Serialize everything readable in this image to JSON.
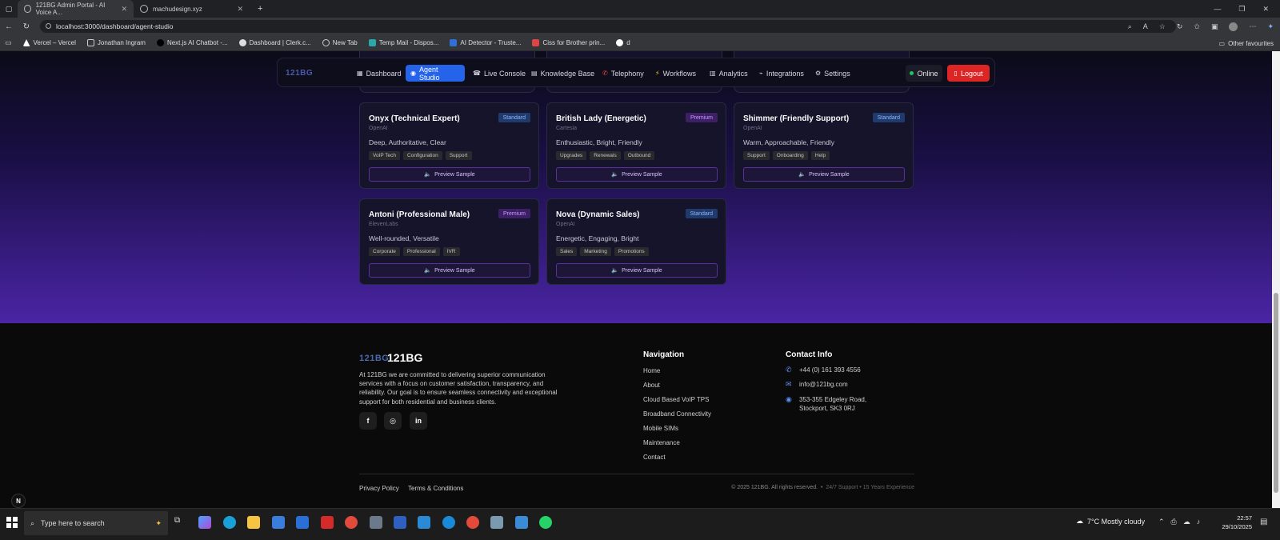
{
  "browser": {
    "tabs": [
      {
        "title": "121BG Admin Portal - AI Voice A..."
      },
      {
        "title": "machudesign.xyz"
      }
    ],
    "new_tab": "+",
    "url": "localhost:3000/dashboard/agent-studio",
    "bookmarks": [
      {
        "label": "Vercel – Vercel"
      },
      {
        "label": "Jonathan Ingram"
      },
      {
        "label": "Next.js AI Chatbot -..."
      },
      {
        "label": "Dashboard | Clerk.c..."
      },
      {
        "label": "New Tab"
      },
      {
        "label": "Temp Mail - Dispos..."
      },
      {
        "label": "AI Detector - Truste..."
      },
      {
        "label": "Ciss for Brother prin..."
      },
      {
        "label": "d"
      }
    ],
    "other_favourites": "Other favourites"
  },
  "nav": {
    "logo": "121BG",
    "items": [
      {
        "label": "Dashboard",
        "icon": "▦"
      },
      {
        "label": "Agent Studio",
        "icon": "◉"
      },
      {
        "label": "Live Console",
        "icon": "☎"
      },
      {
        "label": "Knowledge Base",
        "icon": "▤"
      },
      {
        "label": "Telephony",
        "icon": "✆"
      },
      {
        "label": "Workflows",
        "icon": "⚡"
      },
      {
        "label": "Analytics",
        "icon": "▥"
      },
      {
        "label": "Integrations",
        "icon": "⌁"
      },
      {
        "label": "Settings",
        "icon": "⚙"
      }
    ],
    "status": "Online",
    "logout": "Logout"
  },
  "voices": [
    {
      "name": "Onyx (Technical Expert)",
      "provider": "OpenAI",
      "tier": "Standard",
      "desc": "Deep, Authoritative, Clear",
      "tags": [
        "VoIP Tech",
        "Configuration",
        "Support"
      ],
      "preview": "Preview Sample"
    },
    {
      "name": "British Lady (Energetic)",
      "provider": "Cartesia",
      "tier": "Premium",
      "desc": "Enthusiastic, Bright, Friendly",
      "tags": [
        "Upgrades",
        "Renewals",
        "Outbound"
      ],
      "preview": "Preview Sample"
    },
    {
      "name": "Shimmer (Friendly Support)",
      "provider": "OpenAI",
      "tier": "Standard",
      "desc": "Warm, Approachable, Friendly",
      "tags": [
        "Support",
        "Onboarding",
        "Help"
      ],
      "preview": "Preview Sample"
    },
    {
      "name": "Antoni (Professional Male)",
      "provider": "ElevenLabs",
      "tier": "Premium",
      "desc": "Well-rounded, Versatile",
      "tags": [
        "Corporate",
        "Professional",
        "IVR"
      ],
      "preview": "Preview Sample"
    },
    {
      "name": "Nova (Dynamic Sales)",
      "provider": "OpenAI",
      "tier": "Standard",
      "desc": "Energetic, Engaging, Bright",
      "tags": [
        "Sales",
        "Marketing",
        "Promotions"
      ],
      "preview": "Preview Sample"
    }
  ],
  "footer": {
    "logo_mark": "121BG",
    "brand": "121BG",
    "about": "At 121BG we are committed to delivering superior communication services with a focus on customer satisfaction, transparency, and reliability. Our goal is to ensure seamless connectivity and exceptional support for both residential and business clients.",
    "nav_heading": "Navigation",
    "nav_links": [
      "Home",
      "About",
      "Cloud Based VoIP TPS",
      "Broadband Connectivity",
      "Mobile SIMs",
      "Maintenance",
      "Contact"
    ],
    "contact_heading": "Contact Info",
    "phone": "+44 (0) 161 393 4556",
    "email": "info@121bg.com",
    "address_line1": "353-355 Edgeley Road,",
    "address_line2": "Stockport, SK3 0RJ",
    "privacy": "Privacy Policy",
    "terms": "Terms & Conditions",
    "copyright": "© 2025 121BG. All rights reserved.",
    "tagline": "24/7 Support • 15 Years Experience"
  },
  "taskbar": {
    "search_placeholder": "Type here to search",
    "weather": "7°C  Mostly cloudy",
    "time": "22:57",
    "date": "29/10/2025"
  }
}
